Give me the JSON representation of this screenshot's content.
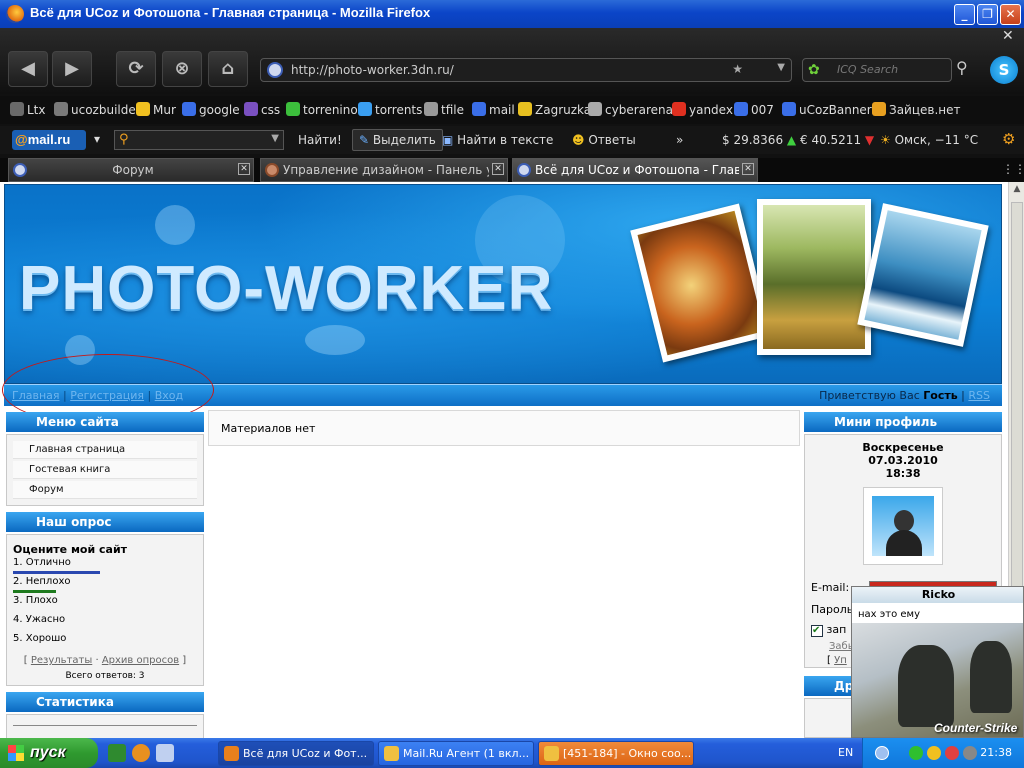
{
  "window": {
    "title": "Всё для UCoz и Фотошопа - Главная страница - Mozilla Firefox"
  },
  "nav": {
    "url": "http://photo-worker.3dn.ru/",
    "lang": "En",
    "icq_placeholder": "ICQ Search"
  },
  "bookmarks": [
    {
      "label": "Ltx",
      "color": "#6a6a6a"
    },
    {
      "label": "ucozbuilder",
      "color": "#7a7a7a"
    },
    {
      "label": "Mur",
      "color": "#f0c020"
    },
    {
      "label": "google",
      "color": "#3a6ee8"
    },
    {
      "label": "css",
      "color": "#7a50c0"
    },
    {
      "label": "torrenino",
      "color": "#3cbf3c"
    },
    {
      "label": "torrents",
      "color": "#3a9ef0"
    },
    {
      "label": "tfile",
      "color": "#999999"
    },
    {
      "label": "mail",
      "color": "#3a6ee8"
    },
    {
      "label": "Zagruzka",
      "color": "#e8c020"
    },
    {
      "label": "cyberarena",
      "color": "#aaaaaa"
    },
    {
      "label": "yandex",
      "color": "#e03020"
    },
    {
      "label": "007",
      "color": "#3a6ee8"
    },
    {
      "label": "uCozBanners",
      "color": "#3a6ee8"
    },
    {
      "label": "Зайцев.нет",
      "color": "#e8a020"
    }
  ],
  "mailbar": {
    "logo_at": "@",
    "logo": "mail.ru",
    "find": "Найти!",
    "highlight": "Выделить",
    "find_in_text": "Найти в тексте",
    "answers": "Ответы",
    "more": "»",
    "usd": "$ 29.8366",
    "eur": "€ 40.5211",
    "weather": "Омск, −11 °C"
  },
  "tabs": [
    {
      "label": "Форум",
      "active": false
    },
    {
      "label": "Управление дизайном - Панель упра...",
      "active": false
    },
    {
      "label": "Всё для UCoz и Фотошопа - Главная ...",
      "active": true
    }
  ],
  "site": {
    "logo": "PHOTO-WORKER",
    "nav_links": [
      "Главная",
      "Регистрация",
      "Вход"
    ],
    "greeting": "Приветствую Вас",
    "guest": "Гость",
    "rss": "RSS",
    "menu": {
      "title": "Меню сайта",
      "items": [
        "Главная страница",
        "Гостевая книга",
        "Форум"
      ]
    },
    "poll": {
      "title": "Наш опрос",
      "question": "Оцените мой сайт",
      "options": [
        {
          "label": "1. Отлично",
          "bar_color": "#2a48b0",
          "share": 0.67
        },
        {
          "label": "2. Неплохо",
          "bar_color": "#1e7a1e",
          "share": 0.33
        },
        {
          "label": "3. Плохо"
        },
        {
          "label": "4. Ужасно"
        },
        {
          "label": "5. Хорошо"
        }
      ],
      "results": "Результаты",
      "archive": "Архив опросов",
      "total": "Всего ответов: 3"
    },
    "stats": {
      "title": "Статистика"
    },
    "content": {
      "empty": "Материалов нет"
    },
    "profile": {
      "title": "Мини профиль",
      "day": "Воскресенье",
      "date": "07.03.2010",
      "time": "18:38",
      "email_label": "E-mail:",
      "password_label": "Пароль",
      "remember": "зап",
      "forgot": "Забы",
      "bottom_link": "Уп"
    },
    "friends": {
      "title": "Др"
    }
  },
  "popup": {
    "title": "Ricko",
    "message": "нах это ему",
    "image_caption": "Counter-Strike"
  },
  "taskbar": {
    "start": "пуск",
    "tasks": [
      {
        "label": "Всё для UCoz и Фот...",
        "state": "active",
        "color": "#e8801c"
      },
      {
        "label": "Mail.Ru Агент (1 вкл...",
        "state": "normal",
        "color": "#f0c040"
      },
      {
        "label": "[451-184] - Окно соо...",
        "state": "flash",
        "color": "#f0c040"
      }
    ],
    "lang": "EN",
    "clock": "21:38"
  }
}
